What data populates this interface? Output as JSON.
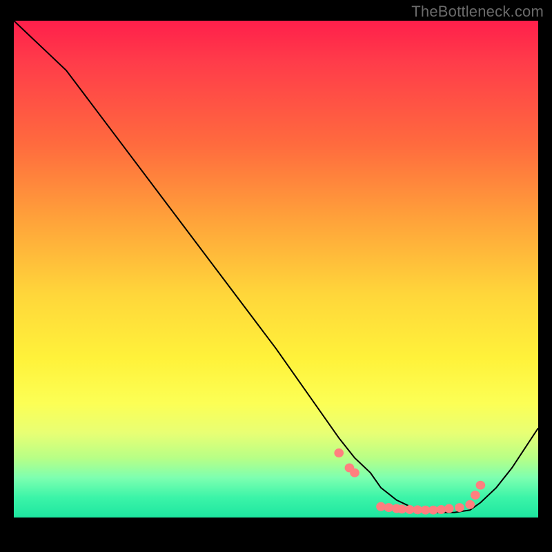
{
  "watermark": "TheBottleneck.com",
  "chart_data": {
    "type": "line",
    "title": "",
    "xlabel": "",
    "ylabel": "",
    "xlim": [
      0,
      100
    ],
    "ylim": [
      0,
      100
    ],
    "series": [
      {
        "name": "curve",
        "x": [
          0,
          3,
          6,
          10,
          20,
          30,
          40,
          50,
          58,
          62,
          65,
          68,
          70,
          73,
          76,
          80,
          84,
          87,
          89,
          92,
          95,
          100
        ],
        "y": [
          100,
          97,
          94,
          90,
          76,
          62,
          48,
          34,
          22,
          16,
          12,
          9,
          6,
          3.5,
          2,
          1,
          1,
          1.5,
          3,
          6,
          10,
          18
        ]
      }
    ],
    "scatter": [
      {
        "name": "dots",
        "color": "#ff7f7f",
        "x": [
          62,
          64,
          65,
          70,
          71.5,
          73,
          74,
          75.5,
          77,
          78.5,
          80,
          81.5,
          83,
          85,
          87,
          88,
          89
        ],
        "y": [
          13,
          10,
          9,
          2.2,
          2.0,
          1.8,
          1.7,
          1.6,
          1.55,
          1.5,
          1.5,
          1.6,
          1.8,
          2.0,
          2.6,
          4.5,
          6.5
        ]
      }
    ],
    "background_gradient": {
      "type": "vertical",
      "stops": [
        {
          "pos": 0.0,
          "color": "#ff1f4b"
        },
        {
          "pos": 0.25,
          "color": "#ff6b3e"
        },
        {
          "pos": 0.55,
          "color": "#ffd63a"
        },
        {
          "pos": 0.8,
          "color": "#f5ff5a"
        },
        {
          "pos": 0.93,
          "color": "#7dffb0"
        },
        {
          "pos": 1.0,
          "color": "#1ee6a0"
        }
      ]
    }
  }
}
